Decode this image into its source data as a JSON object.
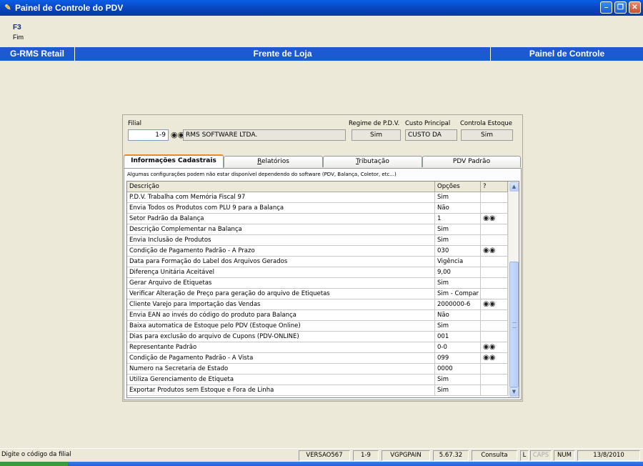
{
  "window": {
    "title": "Painel de Controle do PDV",
    "controls": [
      "minimize",
      "maximize",
      "close"
    ]
  },
  "fkeys": [
    {
      "key": "F3",
      "desc": "Fim"
    }
  ],
  "banner": {
    "left": "G-RMS Retail",
    "center": "Frente de Loja",
    "right": "Painel de Controle"
  },
  "header": {
    "filial_label": "Filial",
    "filial_value": "1-9",
    "company_name": "RMS SOFTWARE LTDA.",
    "regime_label": "Regime de P.D.V.",
    "regime_value": "Sim",
    "custo_label": "Custo Principal",
    "custo_value": "CUSTO DA",
    "estoque_label": "Controla Estoque",
    "estoque_value": "Sim"
  },
  "tabs": [
    {
      "label": "Informações Cadastrais",
      "active": true
    },
    {
      "label": "Relatórios",
      "underline": "R"
    },
    {
      "label": "Tributação",
      "underline": "T"
    },
    {
      "label": "PDV Padrão"
    }
  ],
  "note": "Algumas configurações podem não estar disponível dependendo do software (PDV, Balança, Coletor, etc...)",
  "grid": {
    "columns": [
      "Descrição",
      "Opções",
      "?"
    ],
    "rows": [
      {
        "desc": "P.D.V. Trabalha com Memória Fiscal 97",
        "opt": "Sim",
        "lookup": false
      },
      {
        "desc": "Envia Todos os Produtos com PLU 9 para a Balança",
        "opt": "Não",
        "lookup": false
      },
      {
        "desc": "Setor Padrão da Balança",
        "opt": "1",
        "lookup": true
      },
      {
        "desc": "Descrição Complementar na Balança",
        "opt": "Sim",
        "lookup": false
      },
      {
        "desc": "Envia Inclusão de Produtos",
        "opt": "Sim",
        "lookup": false
      },
      {
        "desc": "Condição de Pagamento Padrão - A Prazo",
        "opt": "030",
        "lookup": true
      },
      {
        "desc": "Data para Formação do Label dos Arquivos Gerados",
        "opt": "Vigência",
        "lookup": false
      },
      {
        "desc": "Diferença Unitária Aceitável",
        "opt": "9,00",
        "lookup": false
      },
      {
        "desc": "Gerar Arquivo de Etiquetas",
        "opt": "Sim",
        "lookup": false
      },
      {
        "desc": "Verificar Alteração de Preço para geração do arquivo de Etiquetas",
        "opt": "Sim - Compar",
        "lookup": false
      },
      {
        "desc": "Cliente Varejo para Importação das Vendas",
        "opt": "2000000-6",
        "lookup": true
      },
      {
        "desc": "Envia EAN ao invés do código do produto para Balança",
        "opt": "Não",
        "lookup": false
      },
      {
        "desc": "Baixa automatica de Estoque pelo PDV (Estoque Online)",
        "opt": "Sim",
        "lookup": false
      },
      {
        "desc": "Dias para exclusão do arquivo de Cupons (PDV-ONLINE)",
        "opt": "001",
        "lookup": false
      },
      {
        "desc": "Representante Padrão",
        "opt": "0-0",
        "lookup": true
      },
      {
        "desc": "Condição de Pagamento Padrão - A Vista",
        "opt": "099",
        "lookup": true
      },
      {
        "desc": "Numero na Secretaria de Estado",
        "opt": "0000",
        "lookup": false
      },
      {
        "desc": "Utiliza Gerenciamento de Etiqueta",
        "opt": "Sim",
        "lookup": false
      },
      {
        "desc": "Exportar Produtos sem Estoque e Fora de Linha",
        "opt": "Sim",
        "lookup": false
      }
    ]
  },
  "status": {
    "message": "Digite o código da filial",
    "version": "VERSAO567",
    "filial": "1-9",
    "program": "VGPGPAIN",
    "build": "5.67.32",
    "mode": "Consulta",
    "l": "L",
    "caps": "CAPS",
    "num": "NUM",
    "date": "13/8/2010"
  },
  "icons": {
    "lookup": "binoculars-icon"
  },
  "colors": {
    "banner": "#1b5ad0",
    "titlebar": "#0a5ee6",
    "background": "#ece9d8"
  }
}
